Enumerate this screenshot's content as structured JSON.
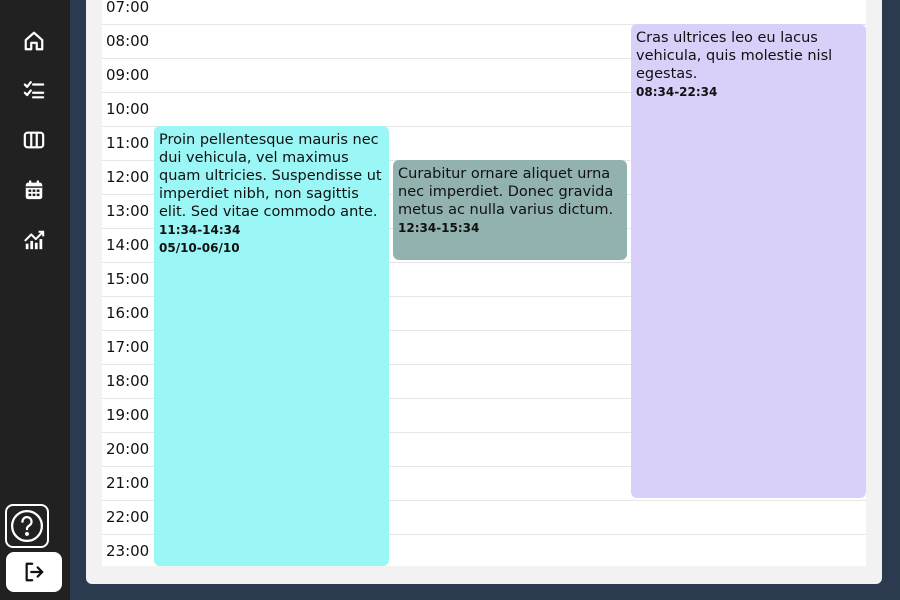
{
  "sidebar": {
    "items": [
      {
        "name": "home",
        "icon": "home-icon"
      },
      {
        "name": "tasks",
        "icon": "checklist-icon"
      },
      {
        "name": "board",
        "icon": "columns-icon"
      },
      {
        "name": "calendar",
        "icon": "calendar-icon"
      },
      {
        "name": "analytics",
        "icon": "chart-icon"
      }
    ],
    "help_icon": "question-circle-icon",
    "logout_icon": "logout-icon"
  },
  "calendar": {
    "hours": [
      "07:00",
      "08:00",
      "09:00",
      "10:00",
      "11:00",
      "12:00",
      "13:00",
      "14:00",
      "15:00",
      "16:00",
      "17:00",
      "18:00",
      "19:00",
      "20:00",
      "21:00",
      "22:00",
      "23:00"
    ],
    "events": [
      {
        "text": "Proin pellentesque mauris nec dui vehicula, vel maximus quam ultricies. Suspendisse ut imperdiet nibh, non sagittis elit. Sed vitae commodo ante.",
        "time": "11:34-14:34",
        "dates": "05/10-06/10",
        "color": "#9bf6f6"
      },
      {
        "text": "Curabitur ornare aliquet urna nec imperdiet. Donec gravida metus ac nulla varius dictum.",
        "time": "12:34-15:34",
        "dates": "",
        "color": "#92b2b0"
      },
      {
        "text": "Cras ultrices leo eu lacus vehicula, quis molestie nisl egestas.",
        "time": "08:34-22:34",
        "dates": "",
        "color": "#d8d0f8"
      }
    ]
  }
}
